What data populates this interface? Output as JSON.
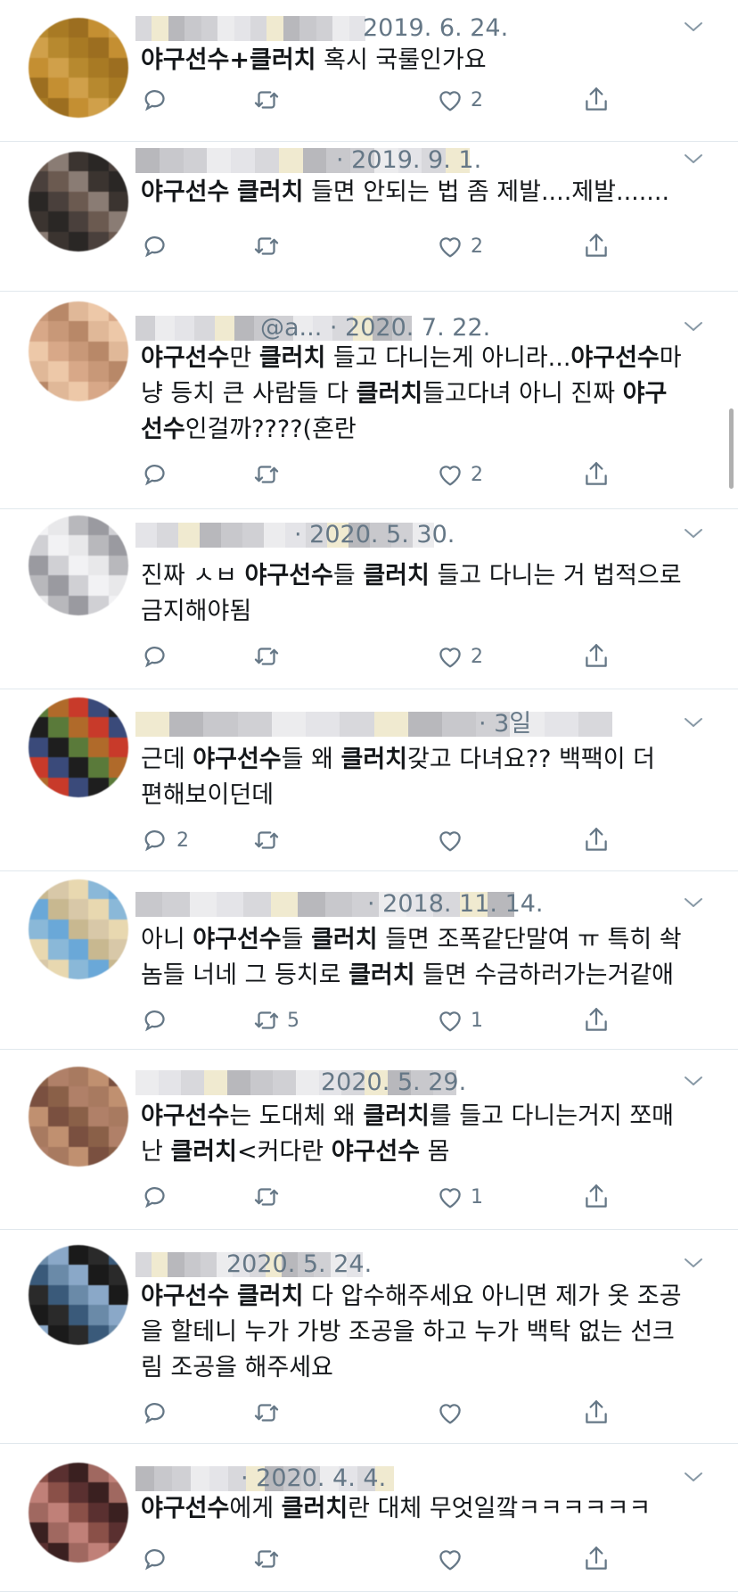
{
  "tweets": [
    {
      "date": "2019. 6. 24.",
      "reply": "",
      "retweet": "",
      "like": "2",
      "segments": [
        [
          {
            "t": "야구선수",
            "b": 1
          },
          {
            "t": "+",
            "b": 1
          },
          {
            "t": "클러치",
            "b": 1
          },
          {
            "t": " 혹시 국룰인가요",
            "b": 0
          }
        ]
      ]
    },
    {
      "date": "· 2019. 9. 1.",
      "reply": "",
      "retweet": "",
      "like": "2",
      "segments": [
        [
          {
            "t": "야구선수",
            "b": 1
          },
          {
            "t": " ",
            "b": 0
          },
          {
            "t": "클러치",
            "b": 1
          },
          {
            "t": " 들면 안되는 법 좀 제발....제발.......",
            "b": 0
          }
        ]
      ]
    },
    {
      "date": "@a... · 2020. 7. 22.",
      "reply": "",
      "retweet": "",
      "like": "2",
      "segments": [
        [
          {
            "t": "야구선수",
            "b": 1
          },
          {
            "t": "만 ",
            "b": 0
          },
          {
            "t": "클러치",
            "b": 1
          },
          {
            "t": " 들고 다니는게 아니라...",
            "b": 0
          },
          {
            "t": "야구선수",
            "b": 1
          },
          {
            "t": "마",
            "b": 0
          }
        ],
        [
          {
            "t": "냥 등치 큰 사람들 다 ",
            "b": 0
          },
          {
            "t": "클러치",
            "b": 1
          },
          {
            "t": "들고다녀 아니 진짜 ",
            "b": 0
          },
          {
            "t": "야구",
            "b": 1
          }
        ],
        [
          {
            "t": "선수",
            "b": 1
          },
          {
            "t": "인걸까????(혼란",
            "b": 0
          }
        ]
      ]
    },
    {
      "date": "· 2020. 5. 30.",
      "reply": "",
      "retweet": "",
      "like": "2",
      "segments": [
        [
          {
            "t": "진짜 ㅅㅂ ",
            "b": 0
          },
          {
            "t": "야구선수",
            "b": 1
          },
          {
            "t": "들 ",
            "b": 0
          },
          {
            "t": "클러치",
            "b": 1
          },
          {
            "t": " 들고 다니는 거 법적으로",
            "b": 0
          }
        ],
        [
          {
            "t": "금지해야됨",
            "b": 0
          }
        ]
      ]
    },
    {
      "date": "· 3일",
      "reply": "2",
      "retweet": "",
      "like": "",
      "segments": [
        [
          {
            "t": "근데 ",
            "b": 0
          },
          {
            "t": "야구선수",
            "b": 1
          },
          {
            "t": "들 왜 ",
            "b": 0
          },
          {
            "t": "클러치",
            "b": 1
          },
          {
            "t": "갖고 다녀요?? 백팩이 더",
            "b": 0
          }
        ],
        [
          {
            "t": "편해보이던데",
            "b": 0
          }
        ]
      ]
    },
    {
      "date": "· 2018. 11. 14.",
      "reply": "",
      "retweet": "5",
      "like": "1",
      "segments": [
        [
          {
            "t": "아니 ",
            "b": 0
          },
          {
            "t": "야구선수",
            "b": 1
          },
          {
            "t": "들 ",
            "b": 0
          },
          {
            "t": "클러치",
            "b": 1
          },
          {
            "t": " 들면 조폭같단말여 ㅠ 특히 솩",
            "b": 0
          }
        ],
        [
          {
            "t": "놈들 너네 그 등치로 ",
            "b": 0
          },
          {
            "t": "클러치",
            "b": 1
          },
          {
            "t": " 들면 수금하러가는거같애",
            "b": 0
          }
        ]
      ]
    },
    {
      "date": "2020. 5. 29.",
      "reply": "",
      "retweet": "",
      "like": "1",
      "segments": [
        [
          {
            "t": "야구선수",
            "b": 1
          },
          {
            "t": "는 도대체 왜 ",
            "b": 0
          },
          {
            "t": "클러치",
            "b": 1
          },
          {
            "t": "를 들고 다니는거지 쪼매",
            "b": 0
          }
        ],
        [
          {
            "t": "난 ",
            "b": 0
          },
          {
            "t": "클러치",
            "b": 1
          },
          {
            "t": "<커다란 ",
            "b": 0
          },
          {
            "t": "야구선수",
            "b": 1
          },
          {
            "t": " 몸",
            "b": 0
          }
        ]
      ]
    },
    {
      "date": "2020. 5. 24.",
      "reply": "",
      "retweet": "",
      "like": "",
      "segments": [
        [
          {
            "t": "야구선수",
            "b": 1
          },
          {
            "t": " ",
            "b": 0
          },
          {
            "t": "클러치",
            "b": 1
          },
          {
            "t": " 다 압수해주세요 아니면 제가 옷 조공",
            "b": 0
          }
        ],
        [
          {
            "t": "을 할테니 누가 가방 조공을 하고 누가 백탁 없는 선크",
            "b": 0
          }
        ],
        [
          {
            "t": "림 조공을 해주세요",
            "b": 0
          }
        ]
      ]
    },
    {
      "date": "· 2020. 4. 4.",
      "reply": "",
      "retweet": "",
      "like": "",
      "segments": [
        [
          {
            "t": "야구선수",
            "b": 1
          },
          {
            "t": "에게 ",
            "b": 0
          },
          {
            "t": "클러치",
            "b": 1
          },
          {
            "t": "란 대체 무엇일깤ㅋㅋㅋㅋㅋㅋ",
            "b": 0
          }
        ]
      ]
    }
  ],
  "colors": {
    "text": "#14171a",
    "meta": "#657786",
    "divider": "#e1e8ed",
    "icon": "#657786"
  },
  "icons": {
    "reply": "reply-icon",
    "retweet": "retweet-icon",
    "like": "heart-icon",
    "share": "share-icon",
    "more": "chevron-down-icon"
  }
}
